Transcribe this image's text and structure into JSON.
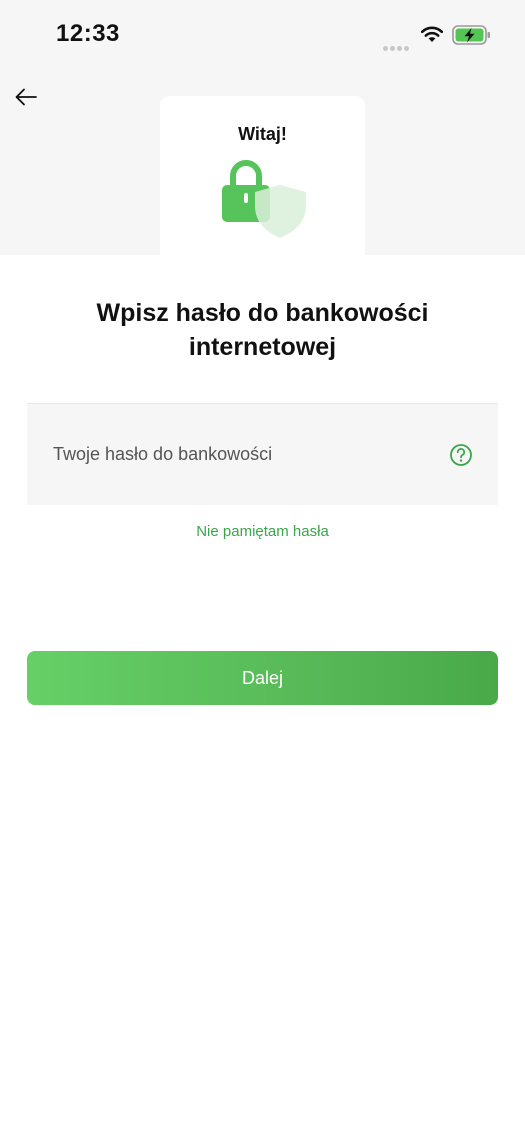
{
  "status_bar": {
    "time": "12:33",
    "icons": [
      "signal-dots-icon",
      "wifi-icon",
      "battery-charging-icon"
    ]
  },
  "header": {
    "back_icon": "arrow-left-icon",
    "card_title": "Witaj!",
    "illustration": "lock-shield-icon"
  },
  "main": {
    "heading": "Wpisz hasło do bankowości internetowej",
    "password_placeholder": "Twoje hasło do bankowości",
    "password_value": "",
    "help_icon": "question-circle-icon",
    "forgot_link": "Nie pamiętam hasła",
    "next_button": "Dalej"
  },
  "colors": {
    "accent_green": "#3aa64a",
    "button_gradient_start": "#66d066",
    "button_gradient_end": "#49a949",
    "top_background": "#f6f6f6"
  }
}
